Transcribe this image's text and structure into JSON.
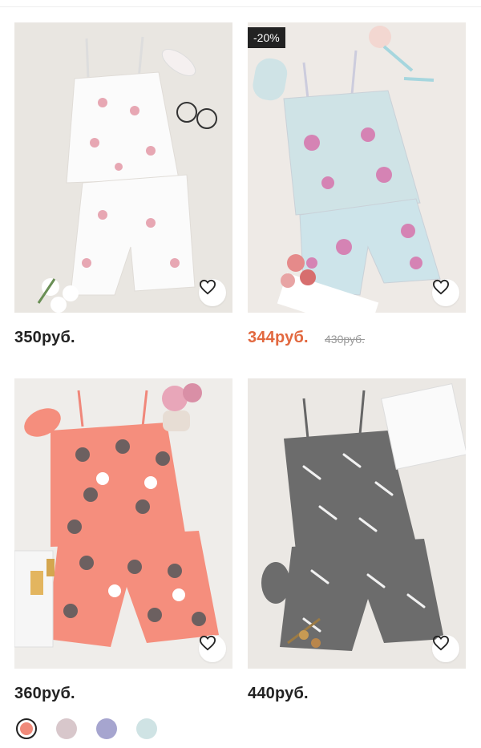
{
  "products": [
    {
      "price": "350руб.",
      "type": "regular"
    },
    {
      "price": "344руб.",
      "old_price": "430руб.",
      "discount": "-20%",
      "type": "sale"
    },
    {
      "price": "360руб.",
      "type": "regular"
    },
    {
      "price": "440руб.",
      "type": "regular"
    }
  ],
  "swatches": [
    {
      "color": "#f08a7a",
      "selected": true
    },
    {
      "color": "#d8c7cb",
      "selected": false
    },
    {
      "color": "#a6a5cf",
      "selected": false
    },
    {
      "color": "#cfe3e4",
      "selected": false
    }
  ],
  "icons": {
    "favorite": "heart-outline-icon"
  }
}
